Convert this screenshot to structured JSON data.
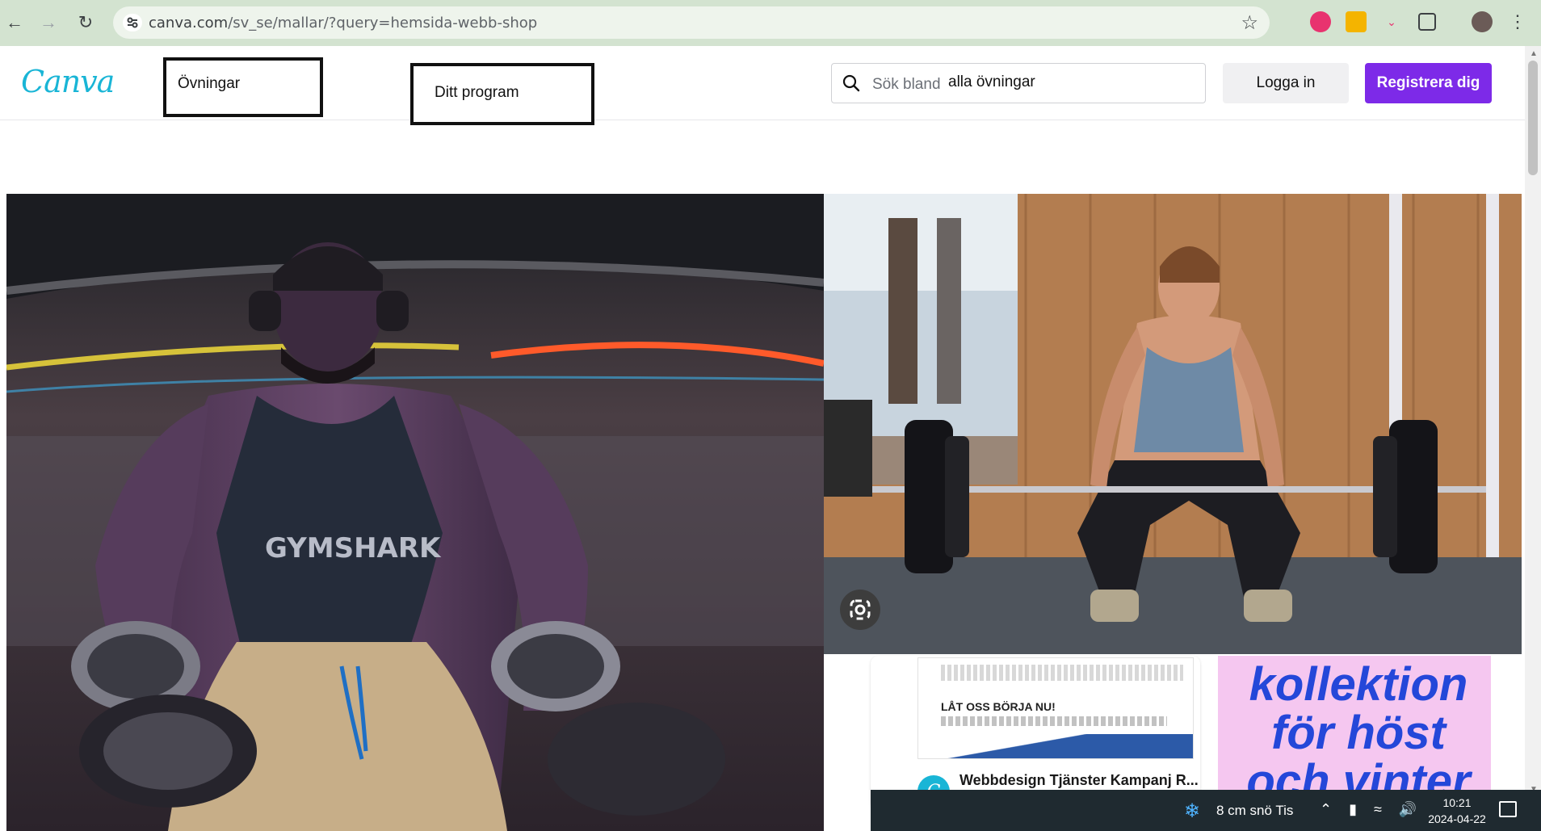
{
  "browser": {
    "url_host": "canva.com",
    "url_path": "/sv_se/mallar/?query=hemsida-webb-shop"
  },
  "header": {
    "logo_text": "Canva",
    "nav_exercises": "Övningar",
    "nav_program": "Ditt program",
    "search_placeholder": "Sök bland",
    "search_value": "alla övningar",
    "login_label": "Logga in",
    "register_label": "Registrera dig"
  },
  "cards": {
    "card1_heading": "LÅT OSS BÖRJA NU!",
    "card1_title": "Webbdesign Tjänster Kampanj R...",
    "card2_text": "kollektion för höst och vinter"
  },
  "taskbar": {
    "weather": "8 cm snö Tis",
    "time": "10:21",
    "date": "2024-04-22"
  },
  "colors": {
    "chrome_bg": "#d3e3d0",
    "canva_brand": "#19b5d6",
    "register_purple": "#7d2ae8",
    "card2_pink": "#f5c7f0",
    "card2_blue": "#2447d9"
  }
}
